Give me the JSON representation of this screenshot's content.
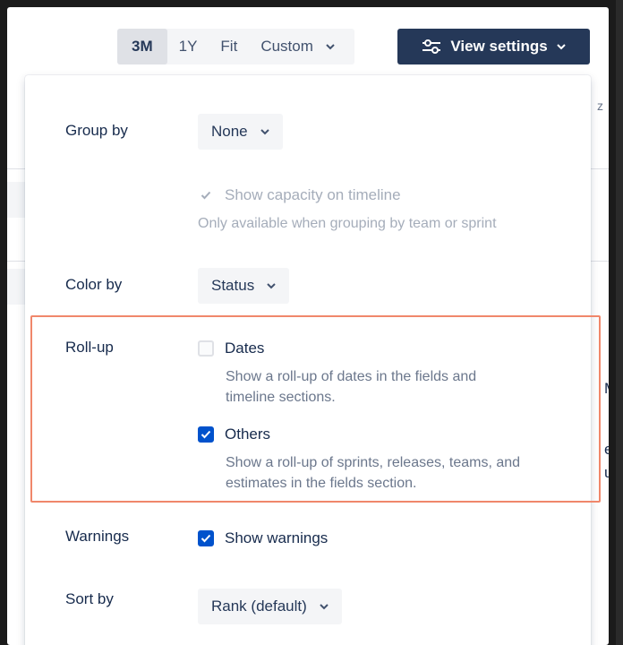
{
  "toolbar": {
    "ranges": [
      {
        "label": "3M",
        "active": true
      },
      {
        "label": "1Y",
        "active": false
      },
      {
        "label": "Fit",
        "active": false
      },
      {
        "label": "Custom",
        "active": false
      }
    ],
    "view_settings_label": "View settings"
  },
  "background": {
    "fragments": [
      "z",
      "M",
      "ee",
      "un"
    ]
  },
  "panel": {
    "group_by": {
      "label": "Group by",
      "value": "None"
    },
    "capacity": {
      "label": "Show capacity on timeline",
      "help": "Only available when grouping by team or sprint",
      "checked": true,
      "disabled": true
    },
    "color_by": {
      "label": "Color by",
      "value": "Status"
    },
    "rollup": {
      "label": "Roll-up",
      "dates": {
        "label": "Dates",
        "checked": false,
        "help_line1": "Show a roll-up of dates in the fields and",
        "help_line2": "timeline sections."
      },
      "others": {
        "label": "Others",
        "checked": true,
        "help_line1": "Show a roll-up of sprints, releases, teams, and",
        "help_line2": "estimates in the fields section."
      }
    },
    "warnings": {
      "label": "Warnings",
      "option": "Show warnings",
      "checked": true
    },
    "sort_by": {
      "label": "Sort by",
      "value": "Rank (default)"
    }
  },
  "colors": {
    "primary_button": "#253858",
    "checkbox_checked": "#0052cc",
    "highlight": "#f0876b"
  }
}
